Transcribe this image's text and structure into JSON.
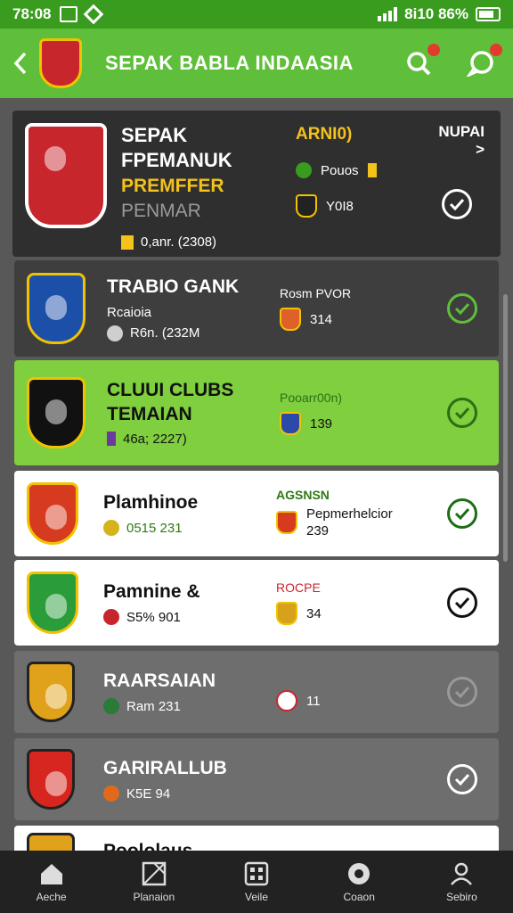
{
  "status": {
    "time": "78:08",
    "right": "8i10 86%"
  },
  "appbar": {
    "title": "SEPAK BABLA INDAASIA",
    "colors": {
      "bar": "#5fbf3a",
      "status": "#3a9c1f"
    }
  },
  "featured": {
    "title": "SEPAK FPEMANUK",
    "title_accent": "ARNI0)",
    "yellow": "PREMFFER",
    "grey": "PENMAR",
    "meta": "0,anr. (2308)",
    "mid1": "Pouos",
    "mid2": "Y0I8",
    "nupai": "NUPAI >"
  },
  "cards": [
    {
      "title": "TRABIO GANK",
      "line2": "Rcaioia",
      "meta": "R6n. (232M",
      "mhead": "Rosm PVOR",
      "mval": "314"
    },
    {
      "title": "CLUUI CLUBS TEMAIAN",
      "meta": "46a; 2227)",
      "mhead": "Pooarr00n)",
      "mval": "139"
    },
    {
      "title": "Plamhinoe",
      "meta": "0515 231",
      "mhead": "AGSNSN",
      "mhead2": "Pepmerhelcior",
      "mval": "239"
    },
    {
      "title": "Pamnine &",
      "meta": "S5% 901",
      "mhead": "ROCPE",
      "mval": "34"
    },
    {
      "title": "RAARSAIAN",
      "meta": "Ram 231",
      "mval": "11"
    },
    {
      "title": "GARIRALLUB",
      "meta": "K5E 94"
    },
    {
      "title": "Poololaus"
    }
  ],
  "nav": [
    {
      "label": "Aeche",
      "icon": "home-icon"
    },
    {
      "label": "Planaion",
      "icon": "pitch-icon"
    },
    {
      "label": "Veile",
      "icon": "grid-icon"
    },
    {
      "label": "Coaon",
      "icon": "ball-icon"
    },
    {
      "label": "Sebiro",
      "icon": "person-icon"
    }
  ]
}
